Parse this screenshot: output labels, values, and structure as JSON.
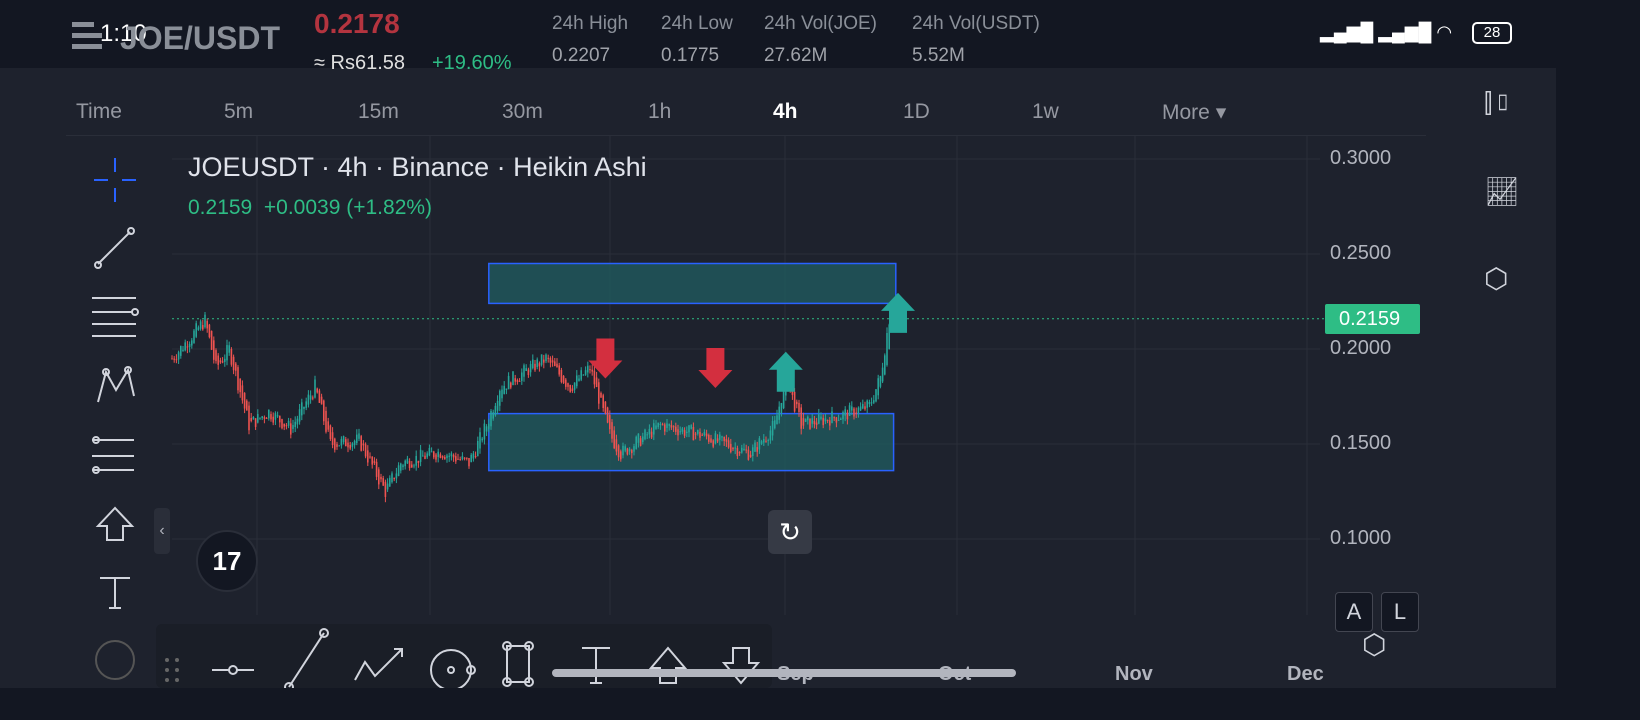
{
  "status_bar": {
    "time": "1:10",
    "battery": "28"
  },
  "header": {
    "pair": "JOE/USDT",
    "last_price": "0.2178",
    "fiat_price": "≈ Rs61.58",
    "change_pct": "+19.60%",
    "stats": [
      {
        "label": "24h High",
        "value": "0.2207"
      },
      {
        "label": "24h Low",
        "value": "0.1775"
      },
      {
        "label": "24h Vol(JOE)",
        "value": "27.62M"
      },
      {
        "label": "24h Vol(USDT)",
        "value": "5.52M"
      }
    ]
  },
  "timeframes": [
    "Time",
    "5m",
    "15m",
    "30m",
    "1h",
    "4h",
    "1D",
    "1w",
    "More"
  ],
  "active_timeframe": "4h",
  "colors": {
    "up": "#26a69a",
    "down": "#ef5350",
    "price_line": "#2ebd85",
    "box_border": "#2962ff",
    "box_fill": "#1f5a5e"
  },
  "chart_data": {
    "type": "candlestick",
    "title": "JOEUSDT · 4h · Binance · Heikin Ashi",
    "ohlc_summary": {
      "last": "0.2159",
      "change": "+0.0039",
      "change_pct": "(+1.82%)"
    },
    "y_ticks": [
      "0.3000",
      "0.2500",
      "0.2000",
      "0.1500",
      "0.1000"
    ],
    "y_tick_values": [
      0.3,
      0.25,
      0.2,
      0.15,
      0.1
    ],
    "x_ticks": [
      "Sep",
      "Oct",
      "Nov",
      "Dec"
    ],
    "current_price_label": "0.2159",
    "current_price": 0.2159,
    "price_path": [
      [
        0,
        0.195
      ],
      [
        15,
        0.215
      ],
      [
        20,
        0.19
      ],
      [
        26,
        0.2
      ],
      [
        35,
        0.16
      ],
      [
        44,
        0.167
      ],
      [
        54,
        0.158
      ],
      [
        65,
        0.18
      ],
      [
        72,
        0.15
      ],
      [
        85,
        0.152
      ],
      [
        97,
        0.125
      ],
      [
        104,
        0.14
      ],
      [
        122,
        0.146
      ],
      [
        135,
        0.14
      ],
      [
        143,
        0.16
      ],
      [
        149,
        0.18
      ],
      [
        170,
        0.195
      ],
      [
        181,
        0.18
      ],
      [
        190,
        0.19
      ],
      [
        199,
        0.155
      ],
      [
        204,
        0.145
      ],
      [
        222,
        0.16
      ],
      [
        240,
        0.155
      ],
      [
        263,
        0.145
      ],
      [
        274,
        0.16
      ],
      [
        279,
        0.185
      ],
      [
        286,
        0.16
      ],
      [
        304,
        0.165
      ],
      [
        317,
        0.17
      ],
      [
        322,
        0.185
      ],
      [
        326,
        0.216
      ]
    ],
    "zones": [
      {
        "from_index": 144,
        "to_index": 329,
        "top": 0.245,
        "bottom": 0.224
      },
      {
        "from_index": 144,
        "to_index": 328,
        "top": 0.166,
        "bottom": 0.136
      }
    ],
    "arrows": [
      {
        "dir": "down",
        "index": 197,
        "price": 0.195
      },
      {
        "dir": "down",
        "index": 247,
        "price": 0.19
      },
      {
        "dir": "up",
        "index": 279,
        "price": 0.188
      },
      {
        "dir": "up",
        "index": 330,
        "price": 0.219
      }
    ]
  },
  "scale_buttons": {
    "auto": "A",
    "log": "L"
  }
}
